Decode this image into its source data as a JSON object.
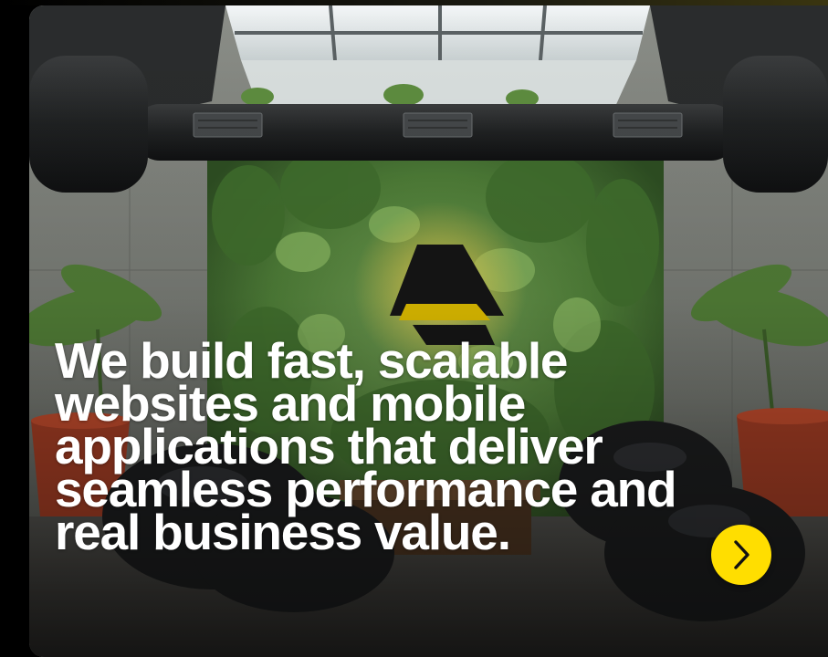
{
  "hero": {
    "headline": "We build fast, scalable websites and mobile applications that deliver seamless performance and real business value."
  },
  "next_button": {
    "icon": "chevron-right-icon",
    "color": "#ffde00",
    "icon_color": "#111111"
  },
  "colors": {
    "page_background": "#000000",
    "text": "#ffffff",
    "logo_accent": "#d9b800"
  }
}
